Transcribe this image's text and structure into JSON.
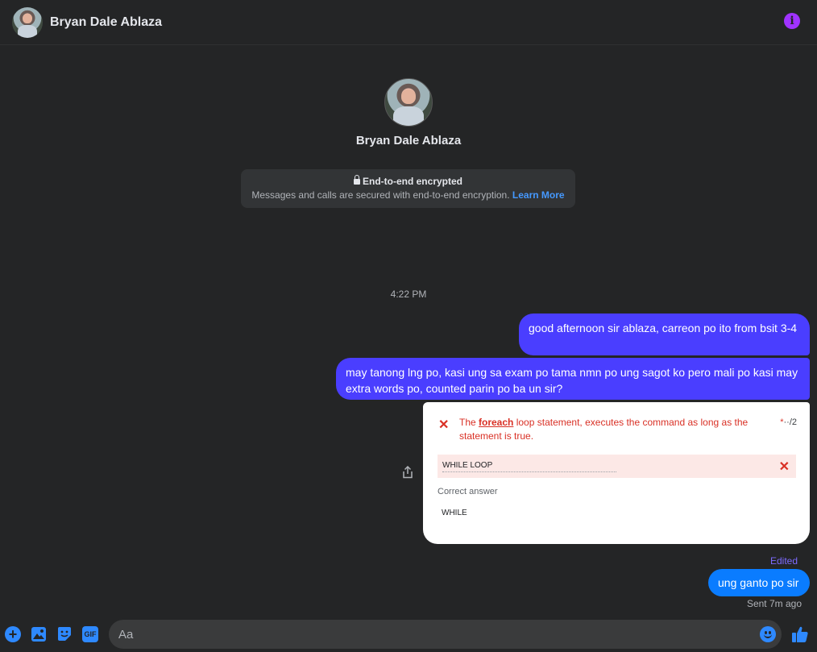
{
  "header": {
    "contact_name": "Bryan Dale Ablaza",
    "info_icon": "info-icon",
    "info_glyph": "i"
  },
  "profile": {
    "name": "Bryan Dale Ablaza"
  },
  "encryption": {
    "title": "End-to-end encrypted",
    "description": "Messages and calls are secured with end-to-end encryption.",
    "link": "Learn More"
  },
  "conversation": {
    "timestamp": "4:22 PM",
    "messages": [
      {
        "text": "good afternoon sir ablaza, carreon po ito from bsit 3-4"
      },
      {
        "text": "may tanong lng po, kasi ung sa exam po tama nmn po ung sagot ko pero mali po kasi may extra words po, counted parin po ba un sir?"
      }
    ],
    "image_message": {
      "question_prefix": "The ",
      "question_keyword": "foreach",
      "question_suffix": " loop statement, executes the command as long as the statement is true.",
      "score_star": "*",
      "score": "··/2",
      "given_answer": "WHILE LOOP",
      "correct_label": "Correct answer",
      "correct_answer": "WHILE",
      "wrong_mark": "✕"
    },
    "edited_label": "Edited",
    "last_message": "ung ganto po sir",
    "status": "Sent 7m ago"
  },
  "composer": {
    "placeholder": "Aa",
    "plus_glyph": "+",
    "gif_label": "GIF"
  },
  "colors": {
    "outgoing_bubble": "#4a3eff",
    "last_bubble": "#0a7cff",
    "accent": "#2e89ff",
    "info": "#a033ff",
    "background": "#242526"
  }
}
